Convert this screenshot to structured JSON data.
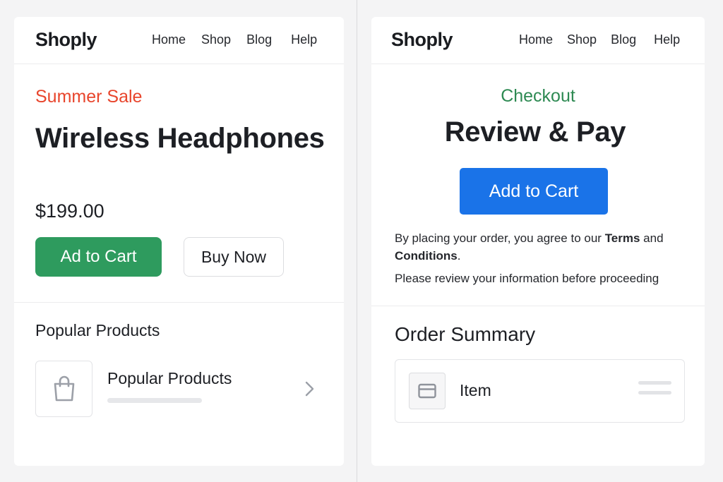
{
  "left_panel": {
    "header": {
      "brand": "Shoply",
      "nav": [
        "Home",
        "Shop",
        "Blog",
        "Help"
      ]
    },
    "hero": {
      "promo": "Summer Sale",
      "title": "Wireless Headphones",
      "price": "$199.00",
      "primary_button": "Ad to Cart",
      "secondary_button": "Buy Now"
    },
    "popular": {
      "section_title": "Popular Products",
      "item_title": "Popular Products",
      "item_icon": "shopping-bag-icon",
      "chevron_icon": "chevron-right-icon"
    }
  },
  "right_panel": {
    "header": {
      "brand": "Shoply",
      "nav": [
        "Home",
        "Shop",
        "Blog",
        "Help"
      ]
    },
    "checkout": {
      "step_label": "Checkout",
      "title": "Review & Pay",
      "button": "Add to Cart",
      "terms_prefix": "By placing your order, you agree to our ",
      "terms_word": "Terms",
      "terms_middle": " and ",
      "conditions_word": "Conditions",
      "terms_suffix": ".",
      "review_note": "Please review your information before proceeding"
    },
    "order_summary": {
      "title": "Order Summary",
      "item_label": "Item",
      "item_icon": "card-icon",
      "handle_icon": "drag-handle-icon"
    }
  },
  "colors": {
    "promo": "#e8452c",
    "green_button": "#2e9b5e",
    "blue_button": "#1a73e8",
    "checkout_label": "#2e8a53"
  }
}
